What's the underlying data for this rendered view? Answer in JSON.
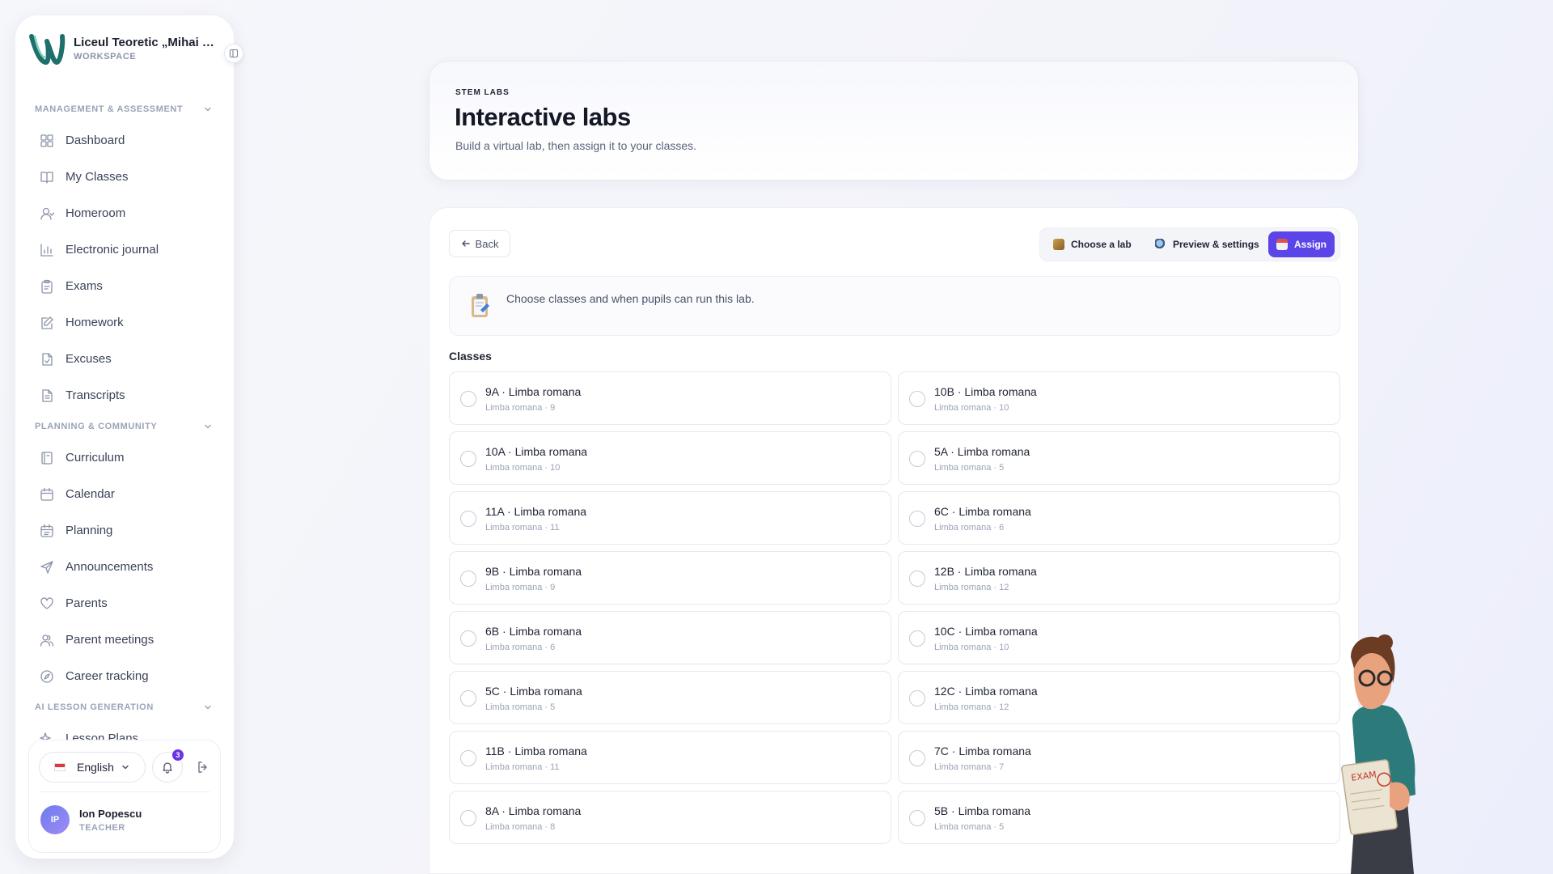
{
  "sidebar": {
    "school": "Liceul Teoretic „Mihai Emi...",
    "workspace": "WORKSPACE",
    "sections": [
      {
        "title": "MANAGEMENT & ASSESSMENT",
        "items": [
          {
            "label": "Dashboard",
            "icon": "dashboard-icon"
          },
          {
            "label": "My Classes",
            "icon": "book-icon"
          },
          {
            "label": "Homeroom",
            "icon": "user-icon"
          },
          {
            "label": "Electronic journal",
            "icon": "chart-icon"
          },
          {
            "label": "Exams",
            "icon": "clipboard-icon"
          },
          {
            "label": "Homework",
            "icon": "edit-icon"
          },
          {
            "label": "Excuses",
            "icon": "file-check-icon"
          },
          {
            "label": "Transcripts",
            "icon": "file-text-icon"
          }
        ]
      },
      {
        "title": "PLANNING & COMMUNITY",
        "items": [
          {
            "label": "Curriculum",
            "icon": "book-open-icon"
          },
          {
            "label": "Calendar",
            "icon": "calendar-icon"
          },
          {
            "label": "Planning",
            "icon": "calendar-check-icon"
          },
          {
            "label": "Announcements",
            "icon": "send-icon"
          },
          {
            "label": "Parents",
            "icon": "heart-icon"
          },
          {
            "label": "Parent meetings",
            "icon": "users-icon"
          },
          {
            "label": "Career tracking",
            "icon": "compass-icon"
          }
        ]
      },
      {
        "title": "AI LESSON GENERATION",
        "items": [
          {
            "label": "Lesson Plans",
            "icon": "sparkles-icon"
          }
        ]
      }
    ],
    "language": "English",
    "notifications": "3",
    "user": {
      "initials": "IP",
      "name": "Ion Popescu",
      "role": "TEACHER"
    }
  },
  "hero": {
    "eyebrow": "STEM LABS",
    "title": "Interactive labs",
    "subtitle": "Build a virtual lab, then assign it to your classes."
  },
  "wizard": {
    "back": "Back",
    "steps": [
      {
        "label": "Choose a lab"
      },
      {
        "label": "Preview & settings"
      },
      {
        "label": "Assign"
      }
    ],
    "info": "Choose classes and when pupils can run this lab.",
    "classes_label": "Classes",
    "classes": [
      {
        "name": "9A · Limba romana",
        "sub": "Limba romana · 9"
      },
      {
        "name": "10B · Limba romana",
        "sub": "Limba romana · 10"
      },
      {
        "name": "10A · Limba romana",
        "sub": "Limba romana · 10"
      },
      {
        "name": "5A · Limba romana",
        "sub": "Limba romana · 5"
      },
      {
        "name": "11A · Limba romana",
        "sub": "Limba romana · 11"
      },
      {
        "name": "6C · Limba romana",
        "sub": "Limba romana · 6"
      },
      {
        "name": "9B · Limba romana",
        "sub": "Limba romana · 9"
      },
      {
        "name": "12B · Limba romana",
        "sub": "Limba romana · 12"
      },
      {
        "name": "6B · Limba romana",
        "sub": "Limba romana · 6"
      },
      {
        "name": "10C · Limba romana",
        "sub": "Limba romana · 10"
      },
      {
        "name": "5C · Limba romana",
        "sub": "Limba romana · 5"
      },
      {
        "name": "12C · Limba romana",
        "sub": "Limba romana · 12"
      },
      {
        "name": "11B · Limba romana",
        "sub": "Limba romana · 11"
      },
      {
        "name": "7C · Limba romana",
        "sub": "Limba romana · 7"
      },
      {
        "name": "8A · Limba romana",
        "sub": "Limba romana · 8"
      },
      {
        "name": "5B · Limba romana",
        "sub": "Limba romana · 5"
      }
    ]
  },
  "colors": {
    "accent": "#5b44e8",
    "brand_teal": "#1f6f6a"
  }
}
